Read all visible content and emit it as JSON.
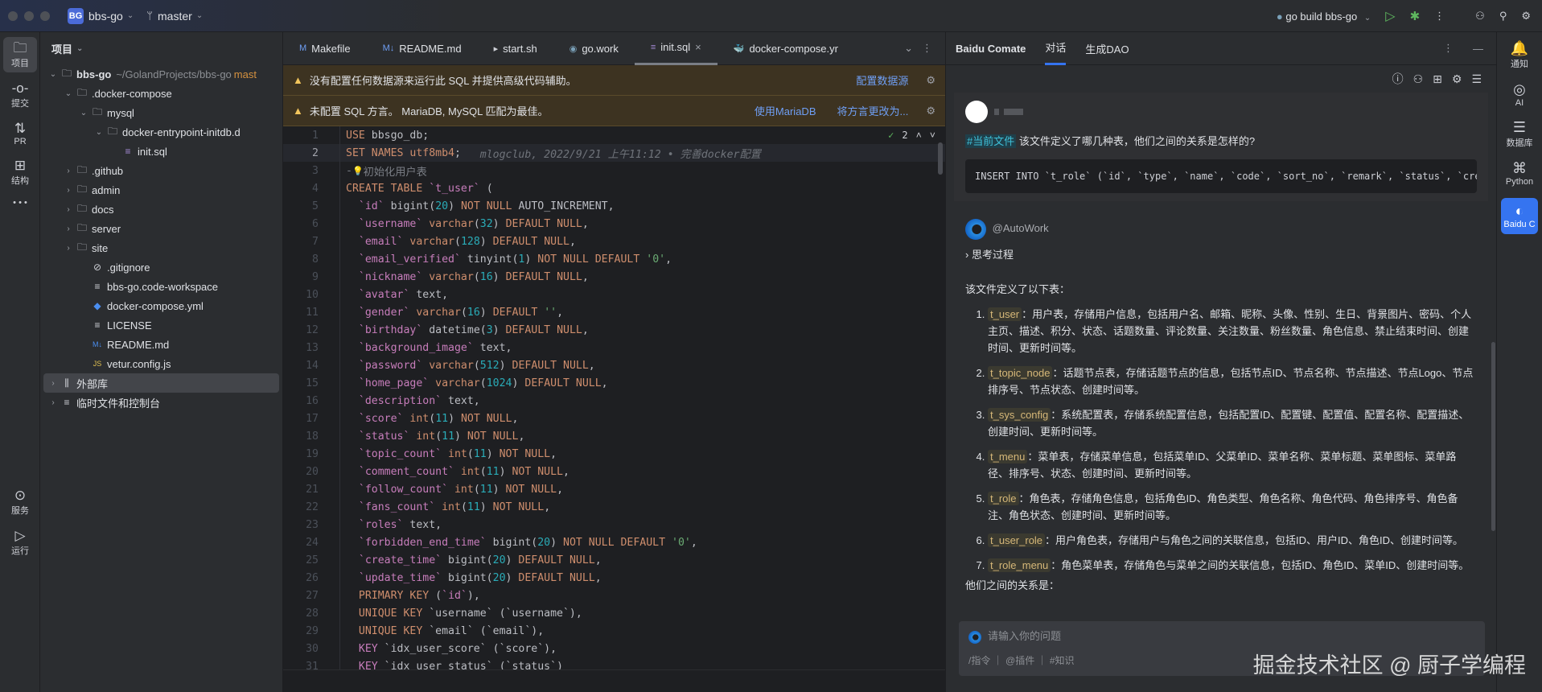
{
  "titlebar": {
    "project_badge": "BG",
    "project": "bbs-go",
    "branch": "master",
    "run_config": "go build bbs-go"
  },
  "left_strip": [
    {
      "label": "项目",
      "icon": "folder-icon"
    },
    {
      "label": "提交",
      "icon": "commit-icon"
    },
    {
      "label": "PR",
      "icon": "pull-request-icon"
    },
    {
      "label": "结构",
      "icon": "structure-icon"
    },
    {
      "label": "服务",
      "icon": "services-icon"
    },
    {
      "label": "运行",
      "icon": "run-icon"
    }
  ],
  "project_panel": {
    "title": "项目",
    "tree": [
      {
        "name": "bbs-go",
        "suffix": "~/GolandProjects/bbs-go",
        "branch": "mast",
        "depth": 0,
        "arrow": "v",
        "icon": "folder",
        "bold": true
      },
      {
        "name": ".docker-compose",
        "depth": 1,
        "arrow": "v",
        "icon": "folder"
      },
      {
        "name": "mysql",
        "depth": 2,
        "arrow": "v",
        "icon": "folder"
      },
      {
        "name": "docker-entrypoint-initdb.d",
        "depth": 3,
        "arrow": "v",
        "icon": "folder"
      },
      {
        "name": "init.sql",
        "depth": 4,
        "arrow": "",
        "icon": "db"
      },
      {
        "name": ".github",
        "depth": 1,
        "arrow": ">",
        "icon": "folder"
      },
      {
        "name": "admin",
        "depth": 1,
        "arrow": ">",
        "icon": "folder"
      },
      {
        "name": "docs",
        "depth": 1,
        "arrow": ">",
        "icon": "folder"
      },
      {
        "name": "server",
        "depth": 1,
        "arrow": ">",
        "icon": "folder"
      },
      {
        "name": "site",
        "depth": 1,
        "arrow": ">",
        "icon": "folder"
      },
      {
        "name": ".gitignore",
        "depth": 2,
        "arrow": "",
        "icon": "ignore"
      },
      {
        "name": "bbs-go.code-workspace",
        "depth": 2,
        "arrow": "",
        "icon": "text"
      },
      {
        "name": "docker-compose.yml",
        "depth": 2,
        "arrow": "",
        "icon": "docker"
      },
      {
        "name": "LICENSE",
        "depth": 2,
        "arrow": "",
        "icon": "text"
      },
      {
        "name": "README.md",
        "depth": 2,
        "arrow": "",
        "icon": "md"
      },
      {
        "name": "vetur.config.js",
        "depth": 2,
        "arrow": "",
        "icon": "js"
      },
      {
        "name": "外部库",
        "depth": 0,
        "arrow": ">",
        "icon": "lib",
        "selected": true
      },
      {
        "name": "临时文件和控制台",
        "depth": 0,
        "arrow": ">",
        "icon": "scratch"
      }
    ]
  },
  "editor": {
    "tabs": [
      {
        "label": "Makefile",
        "icon": "M"
      },
      {
        "label": "README.md",
        "icon": "M↓"
      },
      {
        "label": "start.sh",
        "icon": "▸"
      },
      {
        "label": "go.work",
        "icon": "◉"
      },
      {
        "label": "init.sql",
        "icon": "≡",
        "active": true
      },
      {
        "label": "docker-compose.yml",
        "icon": "🐳"
      }
    ],
    "banners": [
      {
        "text": "没有配置任何数据源来运行此 SQL 并提供高级代码辅助。",
        "links": [
          "配置数据源"
        ]
      },
      {
        "text": "未配置 SQL 方言。 MariaDB, MySQL 匹配为最佳。",
        "links": [
          "使用MariaDB",
          "将方言更改为..."
        ]
      }
    ],
    "inspection_count": "2",
    "current_line": 2,
    "lines": [
      [
        [
          "k",
          "USE"
        ],
        [
          "p",
          " bbsgo_db;"
        ]
      ],
      [
        [
          "k",
          "SET NAMES"
        ],
        [
          "p",
          " "
        ],
        [
          "k",
          "utf8mb4"
        ],
        [
          "p",
          ";"
        ],
        [
          "b",
          "   mlogclub, 2022/9/21 上午11:12 • 完善docker配置"
        ]
      ],
      [
        [
          "c",
          "-"
        ],
        [
          "bulb",
          ""
        ],
        [
          "c",
          "初始化用户表"
        ]
      ],
      [
        [
          "k",
          "CREATE TABLE"
        ],
        [
          "p",
          " "
        ],
        [
          "i",
          "`t_user`"
        ],
        [
          "p",
          " ("
        ]
      ],
      [
        [
          "p",
          "  "
        ],
        [
          "i",
          "`id`"
        ],
        [
          "p",
          " bigint("
        ],
        [
          "n",
          "20"
        ],
        [
          "p",
          ") "
        ],
        [
          "k",
          "NOT NULL"
        ],
        [
          "p",
          " AUTO_INCREMENT,"
        ]
      ],
      [
        [
          "p",
          "  "
        ],
        [
          "i",
          "`username`"
        ],
        [
          "k",
          " varchar"
        ],
        [
          "p",
          "("
        ],
        [
          "n",
          "32"
        ],
        [
          "p",
          ") "
        ],
        [
          "k",
          "DEFAULT NULL"
        ],
        [
          "p",
          ","
        ]
      ],
      [
        [
          "p",
          "  "
        ],
        [
          "i",
          "`email`"
        ],
        [
          "k",
          " varchar"
        ],
        [
          "p",
          "("
        ],
        [
          "n",
          "128"
        ],
        [
          "p",
          ") "
        ],
        [
          "k",
          "DEFAULT NULL"
        ],
        [
          "p",
          ","
        ]
      ],
      [
        [
          "p",
          "  "
        ],
        [
          "i",
          "`email_verified`"
        ],
        [
          "p",
          " tinyint("
        ],
        [
          "n",
          "1"
        ],
        [
          "p",
          ") "
        ],
        [
          "k",
          "NOT NULL DEFAULT"
        ],
        [
          "p",
          " "
        ],
        [
          "s",
          "'0'"
        ],
        [
          "p",
          ","
        ]
      ],
      [
        [
          "p",
          "  "
        ],
        [
          "i",
          "`nickname`"
        ],
        [
          "k",
          " varchar"
        ],
        [
          "p",
          "("
        ],
        [
          "n",
          "16"
        ],
        [
          "p",
          ") "
        ],
        [
          "k",
          "DEFAULT NULL"
        ],
        [
          "p",
          ","
        ]
      ],
      [
        [
          "p",
          "  "
        ],
        [
          "i",
          "`avatar`"
        ],
        [
          "p",
          " text,"
        ]
      ],
      [
        [
          "p",
          "  "
        ],
        [
          "i",
          "`gender`"
        ],
        [
          "k",
          " varchar"
        ],
        [
          "p",
          "("
        ],
        [
          "n",
          "16"
        ],
        [
          "p",
          ") "
        ],
        [
          "k",
          "DEFAULT"
        ],
        [
          "p",
          " "
        ],
        [
          "s",
          "''"
        ],
        [
          "p",
          ","
        ]
      ],
      [
        [
          "p",
          "  "
        ],
        [
          "i",
          "`birthday`"
        ],
        [
          "p",
          " datetime("
        ],
        [
          "n",
          "3"
        ],
        [
          "p",
          ") "
        ],
        [
          "k",
          "DEFAULT NULL"
        ],
        [
          "p",
          ","
        ]
      ],
      [
        [
          "p",
          "  "
        ],
        [
          "i",
          "`background_image`"
        ],
        [
          "p",
          " text,"
        ]
      ],
      [
        [
          "p",
          "  "
        ],
        [
          "i",
          "`password`"
        ],
        [
          "k",
          " varchar"
        ],
        [
          "p",
          "("
        ],
        [
          "n",
          "512"
        ],
        [
          "p",
          ") "
        ],
        [
          "k",
          "DEFAULT NULL"
        ],
        [
          "p",
          ","
        ]
      ],
      [
        [
          "p",
          "  "
        ],
        [
          "i",
          "`home_page`"
        ],
        [
          "k",
          " varchar"
        ],
        [
          "p",
          "("
        ],
        [
          "n",
          "1024"
        ],
        [
          "p",
          ") "
        ],
        [
          "k",
          "DEFAULT NULL"
        ],
        [
          "p",
          ","
        ]
      ],
      [
        [
          "p",
          "  "
        ],
        [
          "i",
          "`description`"
        ],
        [
          "p",
          " text,"
        ]
      ],
      [
        [
          "p",
          "  "
        ],
        [
          "i",
          "`score`"
        ],
        [
          "k",
          " int"
        ],
        [
          "p",
          "("
        ],
        [
          "n",
          "11"
        ],
        [
          "p",
          ") "
        ],
        [
          "k",
          "NOT NULL"
        ],
        [
          "p",
          ","
        ]
      ],
      [
        [
          "p",
          "  "
        ],
        [
          "i",
          "`status`"
        ],
        [
          "k",
          " int"
        ],
        [
          "p",
          "("
        ],
        [
          "n",
          "11"
        ],
        [
          "p",
          ") "
        ],
        [
          "k",
          "NOT NULL"
        ],
        [
          "p",
          ","
        ]
      ],
      [
        [
          "p",
          "  "
        ],
        [
          "i",
          "`topic_count`"
        ],
        [
          "k",
          " int"
        ],
        [
          "p",
          "("
        ],
        [
          "n",
          "11"
        ],
        [
          "p",
          ") "
        ],
        [
          "k",
          "NOT NULL"
        ],
        [
          "p",
          ","
        ]
      ],
      [
        [
          "p",
          "  "
        ],
        [
          "i",
          "`comment_count`"
        ],
        [
          "k",
          " int"
        ],
        [
          "p",
          "("
        ],
        [
          "n",
          "11"
        ],
        [
          "p",
          ") "
        ],
        [
          "k",
          "NOT NULL"
        ],
        [
          "p",
          ","
        ]
      ],
      [
        [
          "p",
          "  "
        ],
        [
          "i",
          "`follow_count`"
        ],
        [
          "k",
          " int"
        ],
        [
          "p",
          "("
        ],
        [
          "n",
          "11"
        ],
        [
          "p",
          ") "
        ],
        [
          "k",
          "NOT NULL"
        ],
        [
          "p",
          ","
        ]
      ],
      [
        [
          "p",
          "  "
        ],
        [
          "i",
          "`fans_count`"
        ],
        [
          "k",
          " int"
        ],
        [
          "p",
          "("
        ],
        [
          "n",
          "11"
        ],
        [
          "p",
          ") "
        ],
        [
          "k",
          "NOT NULL"
        ],
        [
          "p",
          ","
        ]
      ],
      [
        [
          "p",
          "  "
        ],
        [
          "i",
          "`roles`"
        ],
        [
          "p",
          " text,"
        ]
      ],
      [
        [
          "p",
          "  "
        ],
        [
          "i",
          "`forbidden_end_time`"
        ],
        [
          "p",
          " bigint("
        ],
        [
          "n",
          "20"
        ],
        [
          "p",
          ") "
        ],
        [
          "k",
          "NOT NULL DEFAULT"
        ],
        [
          "p",
          " "
        ],
        [
          "s",
          "'0'"
        ],
        [
          "p",
          ","
        ]
      ],
      [
        [
          "p",
          "  "
        ],
        [
          "i",
          "`create_time`"
        ],
        [
          "p",
          " bigint("
        ],
        [
          "n",
          "20"
        ],
        [
          "p",
          ") "
        ],
        [
          "k",
          "DEFAULT NULL"
        ],
        [
          "p",
          ","
        ]
      ],
      [
        [
          "p",
          "  "
        ],
        [
          "i",
          "`update_time`"
        ],
        [
          "p",
          " bigint("
        ],
        [
          "n",
          "20"
        ],
        [
          "p",
          ") "
        ],
        [
          "k",
          "DEFAULT NULL"
        ],
        [
          "p",
          ","
        ]
      ],
      [
        [
          "p",
          "  "
        ],
        [
          "k",
          "PRIMARY KEY"
        ],
        [
          "p",
          " ("
        ],
        [
          "i",
          "`id`"
        ],
        [
          "p",
          "),"
        ]
      ],
      [
        [
          "p",
          "  "
        ],
        [
          "k",
          "UNIQUE KEY"
        ],
        [
          "p",
          " `username` (`username`),"
        ]
      ],
      [
        [
          "p",
          "  "
        ],
        [
          "k",
          "UNIQUE KEY"
        ],
        [
          "p",
          " `email` (`email`),"
        ]
      ],
      [
        [
          "p",
          "  "
        ],
        [
          "i",
          "KEY"
        ],
        [
          "p",
          " `idx_user_score` (`score`),"
        ]
      ],
      [
        [
          "p",
          "  "
        ],
        [
          "i",
          "KEY"
        ],
        [
          "p",
          " `idx_user_status` (`status`)"
        ]
      ]
    ]
  },
  "chat": {
    "title": "Baidu Comate",
    "tabs": [
      "对话",
      "生成DAO"
    ],
    "user_message": {
      "tag": "#当前文件",
      "text": "该文件定义了哪几种表，他们之间的关系是怎样的?",
      "code": "INSERT INTO `t_role` (`id`, `type`, `name`, `code`, `sort_no`, `remark`, `status`, `crea"
    },
    "ai": {
      "name": "@AutoWork",
      "thinking": "思考过程",
      "intro": "该文件定义了以下表：",
      "items": [
        {
          "name": "t_user",
          "desc": "：用户表，存储用户信息，包括用户名、邮箱、昵称、头像、性别、生日、背景图片、密码、个人主页、描述、积分、状态、话题数量、评论数量、关注数量、粉丝数量、角色信息、禁止结束时间、创建时间、更新时间等。"
        },
        {
          "name": "t_topic_node",
          "desc": "：话题节点表，存储话题节点的信息，包括节点ID、节点名称、节点描述、节点Logo、节点排序号、节点状态、创建时间等。"
        },
        {
          "name": "t_sys_config",
          "desc": "：系统配置表，存储系统配置信息，包括配置ID、配置键、配置值、配置名称、配置描述、创建时间、更新时间等。"
        },
        {
          "name": "t_menu",
          "desc": "：菜单表，存储菜单信息，包括菜单ID、父菜单ID、菜单名称、菜单标题、菜单图标、菜单路径、排序号、状态、创建时间、更新时间等。"
        },
        {
          "name": "t_role",
          "desc": "：角色表，存储角色信息，包括角色ID、角色类型、角色名称、角色代码、角色排序号、角色备注、角色状态、创建时间、更新时间等。"
        },
        {
          "name": "t_user_role",
          "desc": "：用户角色表，存储用户与角色之间的关联信息，包括ID、用户ID、角色ID、创建时间等。"
        },
        {
          "name": "t_role_menu",
          "desc": "：角色菜单表，存储角色与菜单之间的关联信息，包括ID、角色ID、菜单ID、创建时间等。"
        }
      ],
      "relation": "他们之间的关系是："
    },
    "input": {
      "placeholder": "请输入你的问题",
      "tools": [
        "/指令",
        "@插件",
        "#知识"
      ]
    }
  },
  "right_strip": [
    {
      "label": "通知",
      "icon": "bell-icon"
    },
    {
      "label": "AI",
      "icon": "ai-icon"
    },
    {
      "label": "数据库",
      "icon": "database-icon"
    },
    {
      "label": "Python",
      "icon": "python-icon"
    },
    {
      "label": "Baidu C",
      "icon": "comate-icon",
      "active": true
    }
  ],
  "watermark": "掘金技术社区 @ 厨子学编程"
}
